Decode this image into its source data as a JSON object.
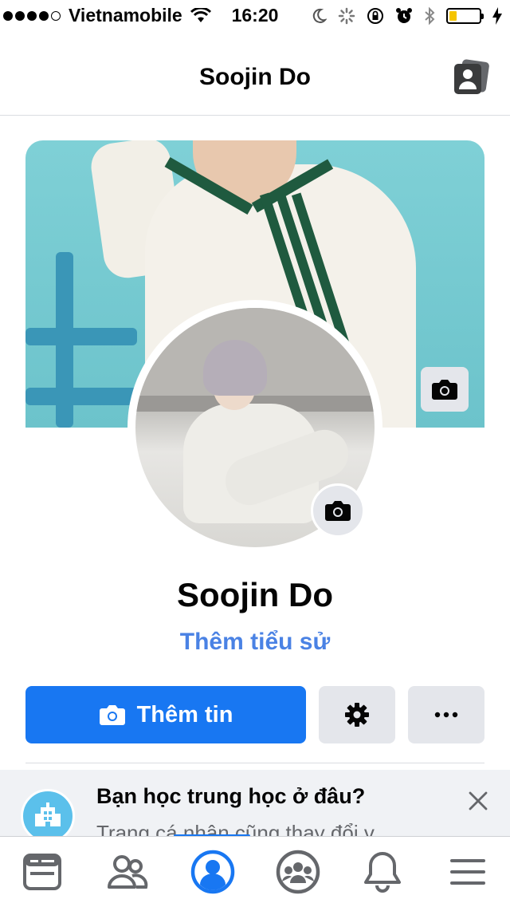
{
  "status_bar": {
    "carrier": "Vietnamobile",
    "time": "16:20",
    "battery_color": "#f5c400"
  },
  "header": {
    "title": "Soojin Do",
    "right_icon": "account-switch-icon"
  },
  "profile": {
    "name": "Soojin Do",
    "bio_link": "Thêm tiểu sử",
    "cover_camera_icon": "camera-icon",
    "avatar_camera_icon": "camera-icon"
  },
  "actions": {
    "primary_label": "Thêm tin",
    "primary_icon": "camera-icon",
    "settings_icon": "gear-icon",
    "more_icon": "more-icon",
    "accent_color": "#1877f2"
  },
  "suggestion": {
    "title": "Bạn học trung học ở đâu?",
    "subtitle": "Trang cá nhân cũng thay đổi v",
    "icon": "school-icon",
    "close_icon": "close-icon"
  },
  "tab_bar": {
    "items": [
      {
        "icon": "news-feed-icon",
        "active": false
      },
      {
        "icon": "friends-icon",
        "active": false
      },
      {
        "icon": "profile-icon",
        "active": true
      },
      {
        "icon": "groups-icon",
        "active": false
      },
      {
        "icon": "bell-icon",
        "active": false
      },
      {
        "icon": "menu-icon",
        "active": false
      }
    ]
  }
}
